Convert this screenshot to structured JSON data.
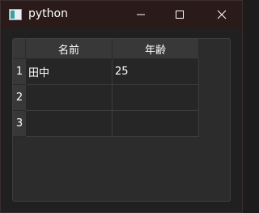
{
  "window": {
    "title": "python",
    "icon": "python-window-icon",
    "controls": [
      "minimize-icon",
      "maximize-icon",
      "close-icon"
    ]
  },
  "table": {
    "columns": [
      "名前",
      "年齢"
    ],
    "row_headers": [
      "1",
      "2",
      "3"
    ],
    "rows": [
      [
        "田中",
        "25"
      ],
      [
        "",
        ""
      ],
      [
        "",
        ""
      ]
    ]
  }
}
